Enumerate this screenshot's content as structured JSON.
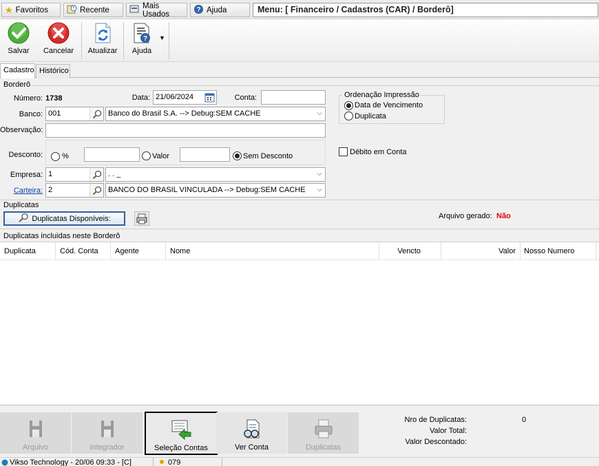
{
  "topbar": {
    "favoritos": "Favoritos",
    "recente": "Recente",
    "mais_usados": "Mais Usados",
    "ajuda": "Ajuda",
    "menu_path": "Menu: [ Financeiro / Cadastros (CAR) / Borderô]"
  },
  "toolbar": {
    "salvar": "Salvar",
    "cancelar": "Cancelar",
    "atualizar": "Atualizar",
    "ajuda": "Ajuda"
  },
  "tabs": {
    "cadastro": "Cadastro",
    "historico": "Histórico"
  },
  "form": {
    "section_bordero": "Borderô",
    "numero_label": "Número:",
    "numero_value": "1738",
    "data_label": "Data:",
    "data_value": "21/06/2024",
    "conta_label": "Conta:",
    "conta_value": "",
    "banco_label": "Banco:",
    "banco_code": "001",
    "banco_name": "Banco do Brasil S.A.   --> Debug:SEM CACHE",
    "observacao_label": "Observação:",
    "observacao_value": "",
    "desconto_label": "Desconto:",
    "desconto_pct_label": "%",
    "desconto_pct_value": "",
    "desconto_valor_label": "Valor",
    "desconto_valor_value": "",
    "desconto_sem_label": "Sem Desconto",
    "empresa_label": "Empresa:",
    "empresa_code": "1",
    "empresa_name": ". . _",
    "carteira_label": "Carteira:",
    "carteira_code": "2",
    "carteira_name": "BANCO DO BRASIL VINCULADA   --> Debug:SEM CACHE",
    "ordenacao_title": "Ordenação Impressão",
    "ordenacao_opt1": "Data de Vencimento",
    "ordenacao_opt2": "Duplicata",
    "debito_label": "Débito em Conta"
  },
  "duplicatas": {
    "section_label": "Duplicatas",
    "disponiveis_button": "Duplicatas Disponíveis:",
    "arquivo_label": "Arquivo gerado:",
    "arquivo_value": "Não",
    "incluidas_label": "Duplicatas incluidas neste Borderô"
  },
  "grid": {
    "columns": [
      "Duplicata",
      "Cód. Conta",
      "Agente",
      "Nome",
      "Vencto",
      "Valor",
      "Nosso Numero"
    ],
    "rows": []
  },
  "bottom": {
    "arquivo": "Arquivo",
    "integrador": "Integrador",
    "selecao_contas": "Seleção Contas",
    "ver_conta": "Ver Conta",
    "duplicatas": "Duplicatas",
    "nro_label": "Nro de Duplicatas:",
    "nro_value": "0",
    "valor_total_label": "Valor Total:",
    "valor_total_value": "",
    "valor_desc_label": "Valor Descontado:",
    "valor_desc_value": ""
  },
  "statusbar": {
    "company": "Vikso Technology - 20/06 09:33 - [C]",
    "code": "079"
  },
  "colors": {
    "accent_red": "#e00000",
    "link_blue": "#0645ad"
  }
}
